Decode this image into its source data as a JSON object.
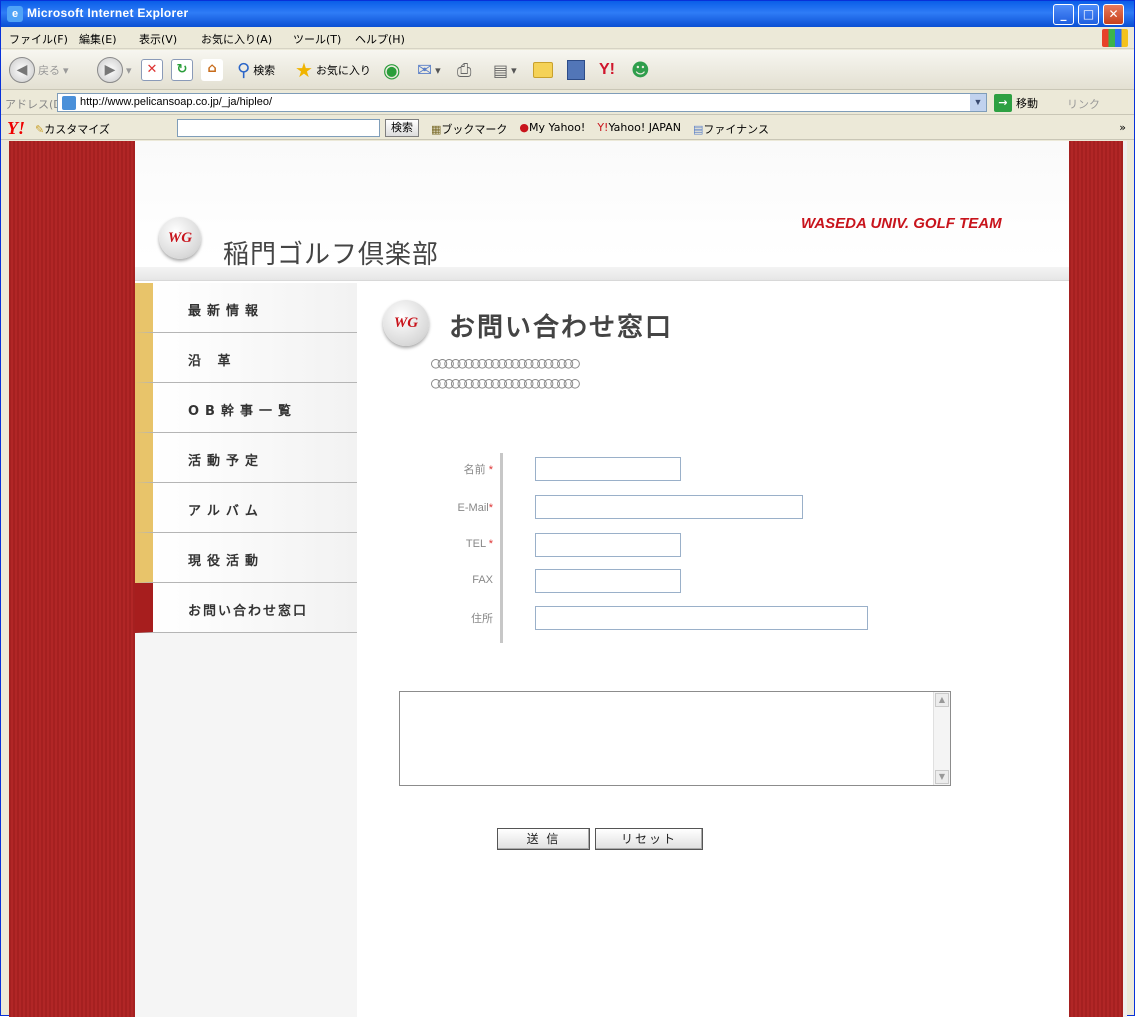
{
  "window": {
    "title": "Microsoft Internet Explorer",
    "controls": {
      "minimize": "_",
      "maximize": "□",
      "close": "✕"
    }
  },
  "menu": [
    "ファイル(F)",
    "編集(E)",
    "表示(V)",
    "お気に入り(A)",
    "ツール(T)",
    "ヘルプ(H)"
  ],
  "toolbar": {
    "back": "戻る",
    "search": "検索",
    "favorites": "お気に入り"
  },
  "address": {
    "label": "アドレス(D)",
    "url": "http://www.pelicansoap.co.jp/_ja/hipleo/",
    "go": "移動",
    "links": "リンク"
  },
  "yahoo_bar": {
    "logo": "Y!",
    "customize": "カスタマイズ",
    "search_button": "検索",
    "items": [
      "ブックマーク",
      "My Yahoo!",
      "Yahoo! JAPAN",
      "ファイナンス"
    ],
    "more": "»"
  },
  "site": {
    "logo_text": "WG",
    "title": "稲門ゴルフ倶楽部",
    "tagline": "WASEDA UNIV. GOLF TEAM"
  },
  "nav": {
    "items": [
      {
        "label": "最新情報"
      },
      {
        "label": "沿 革"
      },
      {
        "label": "OB幹事一覧"
      },
      {
        "label": "活動予定"
      },
      {
        "label": "アルバム"
      },
      {
        "label": "現役活動"
      },
      {
        "label": "お問い合わせ窓口"
      }
    ],
    "active_index": 6
  },
  "page": {
    "title": "お問い合わせ窓口",
    "placeholder_line1": "○○○○○○○○○○○○○○○○○○○○○○",
    "placeholder_line2": "○○○○○○○○○○○○○○○○○○○○○○"
  },
  "form": {
    "name_label": "名前",
    "email_label": "E-Mail",
    "tel_label": "TEL",
    "fax_label": "FAX",
    "address_label": "住所",
    "required_mark": "*",
    "name_value": "",
    "email_value": "",
    "tel_value": "",
    "fax_value": "",
    "address_value": "",
    "message_value": "",
    "submit_label": "送 信",
    "reset_label": "リセット"
  },
  "colors": {
    "stripe": "#a92321",
    "brand_red": "#c8141c",
    "nav_accent": "#e8c46a",
    "nav_active_accent": "#a71e1e"
  }
}
